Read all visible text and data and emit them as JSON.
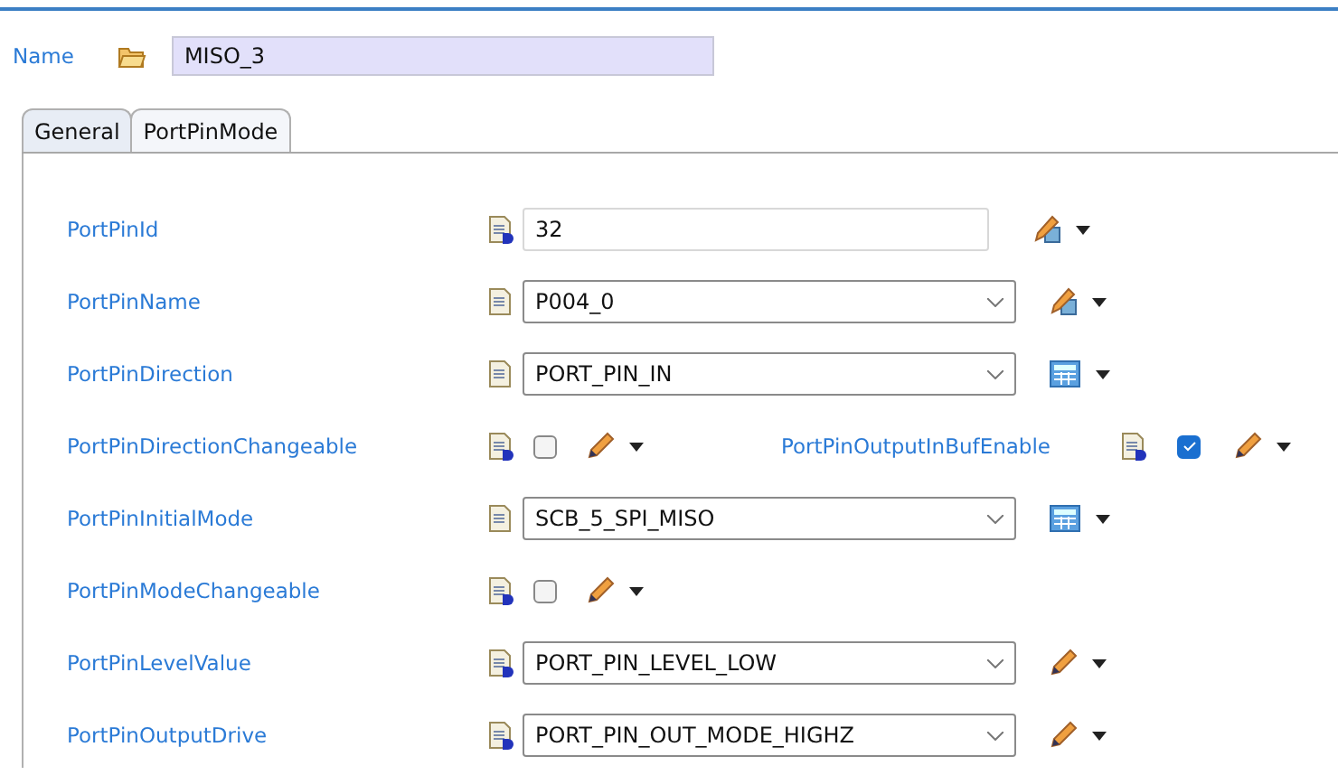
{
  "name_field": {
    "label": "Name",
    "value": "MISO_3"
  },
  "tabs": [
    {
      "label": "General",
      "selected": true
    },
    {
      "label": "PortPinMode",
      "selected": false
    }
  ],
  "params": [
    {
      "label": "PortPinId",
      "kind": "text",
      "value": "32",
      "action": {
        "kind": "formula"
      }
    },
    {
      "label": "PortPinName",
      "kind": "combo",
      "value": "P004_0",
      "action": {
        "kind": "formula"
      }
    },
    {
      "label": "PortPinDirection",
      "kind": "combo",
      "value": "PORT_PIN_IN",
      "action": {
        "kind": "calculator"
      }
    },
    {
      "label": "PortPinDirectionChangeable",
      "kind": "check",
      "checked": false,
      "action": {
        "kind": "edit"
      },
      "extra": {
        "label": "PortPinOutputInBufEnable",
        "checked": true
      }
    },
    {
      "label": "PortPinInitialMode",
      "kind": "combo",
      "value": "SCB_5_SPI_MISO",
      "action": {
        "kind": "calculator"
      }
    },
    {
      "label": "PortPinModeChangeable",
      "kind": "check",
      "checked": false,
      "action": {
        "kind": "edit"
      }
    },
    {
      "label": "PortPinLevelValue",
      "kind": "combo",
      "value": "PORT_PIN_LEVEL_LOW",
      "action": {
        "kind": "edit"
      }
    },
    {
      "label": "PortPinOutputDrive",
      "kind": "combo",
      "value": "PORT_PIN_OUT_MODE_HIGHZ",
      "action": {
        "kind": "edit"
      }
    }
  ]
}
